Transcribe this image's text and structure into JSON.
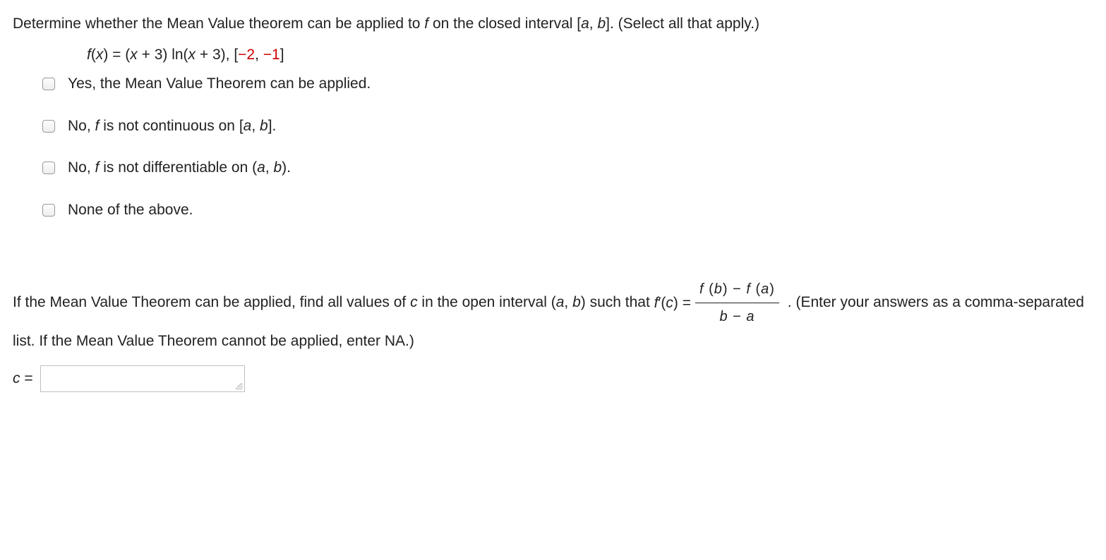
{
  "question": {
    "prompt_pre": "Determine whether the Mean Value theorem can be applied to ",
    "prompt_f": "f",
    "prompt_mid": " on the closed interval [",
    "prompt_a": "a",
    "prompt_comma": ", ",
    "prompt_b": "b",
    "prompt_post": "]. (Select all that apply.)"
  },
  "formula": {
    "fx": "f",
    "of_x": "(",
    "x1": "x",
    "eq": ") = (",
    "x2": "x",
    "plus3a": " + 3) ln(",
    "x3": "x",
    "plus3b": " + 3), [",
    "neg2": "−2",
    "comma": ", ",
    "neg1": "−1",
    "close": "]"
  },
  "options": [
    {
      "label": "Yes, the Mean Value Theorem can be applied."
    },
    {
      "label_pre": "No, ",
      "label_f": "f",
      "label_mid": " is not continuous on [",
      "label_a": "a",
      "label_c": ", ",
      "label_b": "b",
      "label_post": "]."
    },
    {
      "label_pre": "No, ",
      "label_f": "f",
      "label_mid": " is not differentiable on (",
      "label_a": "a",
      "label_c": ", ",
      "label_b": "b",
      "label_post": ")."
    },
    {
      "label": "None of the above."
    }
  ],
  "part2": {
    "t1": "If the Mean Value Theorem can be applied, find all values of ",
    "c": "c",
    "t2": " in the open interval (",
    "a": "a",
    "comma": ", ",
    "b": "b",
    "t3": ") such that ",
    "fprime": "f ",
    "prime_sym": "′(",
    "c2": "c",
    "eq": ") = ",
    "frac_num_pre": "f",
    "frac_num_open1": " (",
    "frac_num_b": "b",
    "frac_num_close1": ") − ",
    "frac_num_f2": "f",
    "frac_num_open2": " (",
    "frac_num_a": "a",
    "frac_num_close2": ")",
    "frac_den_b": "b",
    "frac_den_minus": " − ",
    "frac_den_a": "a",
    "t4": " . (Enter your answers as a comma-separated list. If the Mean Value Theorem cannot be applied, enter NA.)",
    "answer_label_c": "c",
    "answer_label_eq": " ="
  },
  "answer": {
    "value": ""
  }
}
